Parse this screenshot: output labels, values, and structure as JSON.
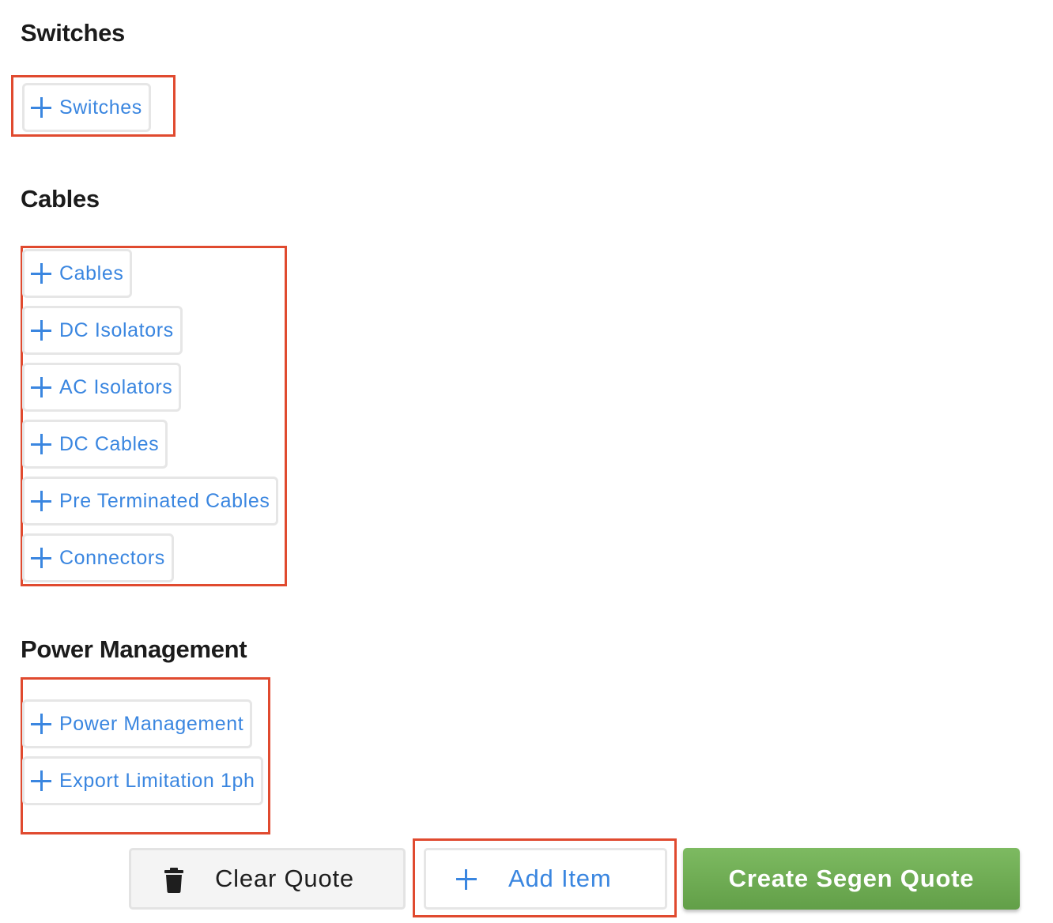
{
  "sections": {
    "switches": {
      "title": "Switches",
      "items": [
        {
          "label": "Switches"
        }
      ]
    },
    "cables": {
      "title": "Cables",
      "items": [
        {
          "label": "Cables"
        },
        {
          "label": "DC Isolators"
        },
        {
          "label": "AC Isolators"
        },
        {
          "label": "DC Cables"
        },
        {
          "label": "Pre Terminated Cables"
        },
        {
          "label": "Connectors"
        }
      ]
    },
    "power_management": {
      "title": "Power Management",
      "items": [
        {
          "label": "Power Management"
        },
        {
          "label": "Export Limitation 1ph"
        }
      ]
    }
  },
  "actions": {
    "clear_label": "Clear Quote",
    "add_label": "Add Item",
    "create_label": "Create Segen Quote"
  },
  "colors": {
    "accent_blue": "#3a86e0",
    "highlight_red": "#e04a2f",
    "create_green": "#6aa84f"
  },
  "icons": {
    "item_icon": "plus-icon",
    "clear_icon": "trash-icon",
    "add_icon": "plus-icon"
  }
}
